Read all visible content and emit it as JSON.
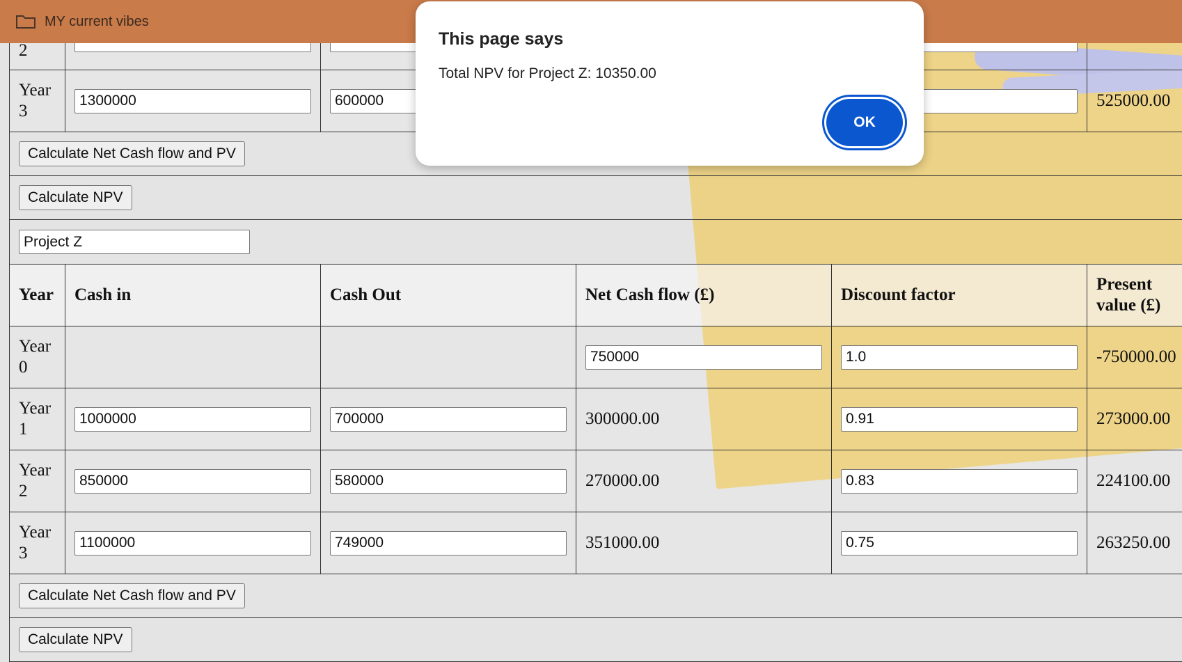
{
  "window": {
    "title": "MY current vibes",
    "icon": "folder-icon"
  },
  "dialog": {
    "title": "This page says",
    "message": "Total NPV for Project Z: 10350.00",
    "ok_label": "OK",
    "accent": "#0b57d0"
  },
  "prev_project": {
    "partial_row_label": "2",
    "year3": {
      "label": "Year 3",
      "cash_in": "1300000",
      "cash_out": "600000",
      "present_value": "525000.00"
    },
    "calc_pv_label": "Calculate Net Cash flow and PV",
    "calc_npv_label": "Calculate NPV"
  },
  "project_z": {
    "name": "Project Z",
    "headers": {
      "year": "Year",
      "cash_in": "Cash in",
      "cash_out": "Cash Out",
      "net": "Net Cash flow (£)",
      "discount": "Discount factor",
      "pv": "Present value (£)"
    },
    "rows": [
      {
        "label": "Year 0",
        "cash_in": "",
        "cash_out": "",
        "net": "750000",
        "discount": "1.0",
        "pv": "-750000.00"
      },
      {
        "label": "Year 1",
        "cash_in": "1000000",
        "cash_out": "700000",
        "net": "300000.00",
        "discount": "0.91",
        "pv": "273000.00"
      },
      {
        "label": "Year 2",
        "cash_in": "850000",
        "cash_out": "580000",
        "net": "270000.00",
        "discount": "0.83",
        "pv": "224100.00"
      },
      {
        "label": "Year 3",
        "cash_in": "1100000",
        "cash_out": "749000",
        "net": "351000.00",
        "discount": "0.75",
        "pv": "263250.00"
      }
    ],
    "calc_pv_label": "Calculate Net Cash flow and PV",
    "calc_npv_label": "Calculate NPV"
  }
}
